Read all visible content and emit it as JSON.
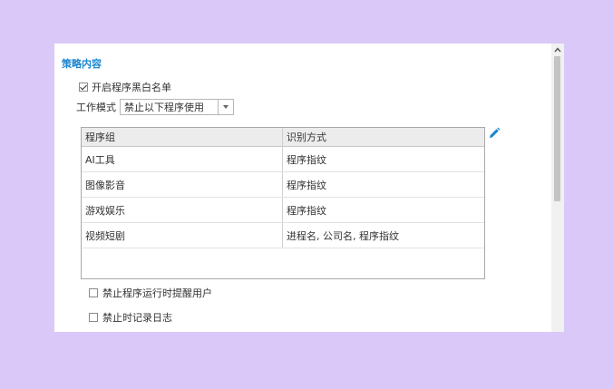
{
  "section": {
    "title": "策略内容"
  },
  "enable_list": {
    "label": "开启程序黑白名单",
    "checked": true
  },
  "work_mode": {
    "label": "工作模式",
    "selected": "禁止以下程序使用"
  },
  "table": {
    "columns": [
      "程序组",
      "识别方式"
    ],
    "rows": [
      [
        "AI工具",
        "程序指纹"
      ],
      [
        "图像影音",
        "程序指纹"
      ],
      [
        "游戏娱乐",
        "程序指纹"
      ],
      [
        "视频短剧",
        "进程名, 公司名, 程序指纹"
      ]
    ]
  },
  "options": [
    {
      "label": "禁止程序运行时提醒用户",
      "checked": false
    },
    {
      "label": "禁止时记录日志",
      "checked": false
    }
  ],
  "icons": {
    "edit": "pencil-icon",
    "scroll_up": "chevron-up-icon"
  },
  "colors": {
    "accent": "#1a86d0",
    "background": "#d9c8f8"
  }
}
